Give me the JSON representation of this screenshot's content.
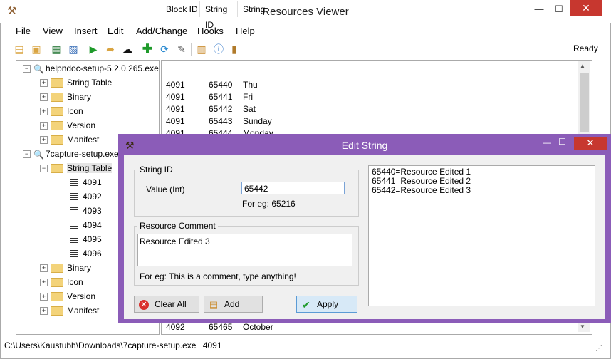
{
  "window": {
    "title": "Resources Viewer",
    "min": "—",
    "max": "☐",
    "close": "✕"
  },
  "menu": [
    "File",
    "View",
    "Insert",
    "Edit",
    "Add/Change",
    "Hooks",
    "Help"
  ],
  "toolbar": {
    "status": "Ready"
  },
  "tree": {
    "file1": "helpndoc-setup-5.2.0.265.exe",
    "file1_children": [
      "String Table",
      "Binary",
      "Icon",
      "Version",
      "Manifest"
    ],
    "file2": "7capture-setup.exe",
    "string_table": "String Table",
    "blocks": [
      "4091",
      "4092",
      "4093",
      "4094",
      "4095",
      "4096"
    ],
    "file2_children": [
      "Binary",
      "Icon",
      "Version",
      "Manifest"
    ]
  },
  "list": {
    "headers": [
      "Block ID",
      "String ID",
      "String"
    ],
    "rows": [
      [
        "4091",
        "65440",
        "Thu"
      ],
      [
        "4091",
        "65441",
        "Fri"
      ],
      [
        "4091",
        "65442",
        "Sat"
      ],
      [
        "4091",
        "65443",
        "Sunday"
      ],
      [
        "4091",
        "65444",
        "Monday"
      ]
    ],
    "bottom_row": [
      "4092",
      "65465",
      "October"
    ]
  },
  "status": {
    "path": "C:\\Users\\Kaustubh\\Downloads\\7capture-setup.exe",
    "block": "4091"
  },
  "dialog": {
    "title": "Edit String",
    "close": "✕",
    "string_id_group": "String ID",
    "value_label": "Value (Int)",
    "value": "65442",
    "value_hint": "For eg: 65216",
    "comment_group": "Resource Comment",
    "comment": "Resource Edited 3",
    "comment_hint": "For eg: This is a comment, type anything!",
    "clear_label": "Clear All",
    "add_label": "Add",
    "apply_label": "Apply",
    "output_lines": [
      "65440=Resource Edited 1",
      "65441=Resource Edited 2",
      "65442=Resource Edited 3"
    ]
  },
  "colors": {
    "dialog_frame": "#8b5cb8",
    "close_red": "#c7372f",
    "folder": "#f3d37a"
  }
}
